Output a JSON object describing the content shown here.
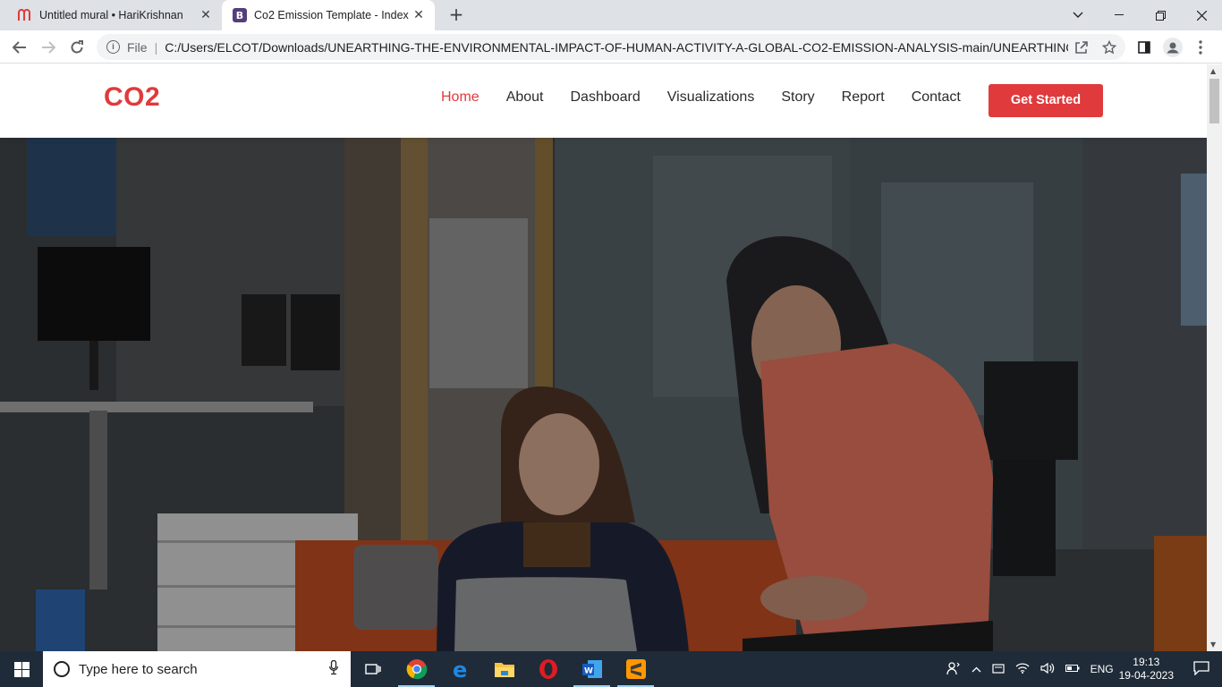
{
  "browser": {
    "tabs": [
      {
        "title": "Untitled mural • HariKrishnan",
        "icon": "mural-icon"
      },
      {
        "title": "Co2 Emission Template - Index",
        "icon": "bootstrap-icon"
      }
    ],
    "file_label": "File",
    "url": "C:/Users/ELCOT/Downloads/UNEARTHING-THE-ENVIRONMENTAL-IMPACT-OF-HUMAN-ACTIVITY-A-GLOBAL-CO2-EMISSION-ANALYSIS-main/UNEARTHING-THE..."
  },
  "site": {
    "logo": "CO2",
    "nav": [
      {
        "label": "Home",
        "active": true
      },
      {
        "label": "About"
      },
      {
        "label": "Dashboard"
      },
      {
        "label": "Visualizations"
      },
      {
        "label": "Story"
      },
      {
        "label": "Report"
      },
      {
        "label": "Contact"
      }
    ],
    "cta": "Get Started",
    "accent": "#e03a3c"
  },
  "taskbar": {
    "search_placeholder": "Type here to search",
    "language": "ENG",
    "time": "19:13",
    "date": "19-04-2023"
  }
}
